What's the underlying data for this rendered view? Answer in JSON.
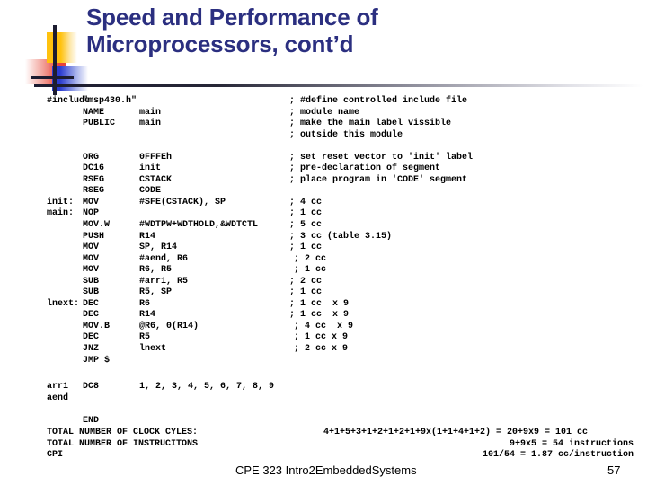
{
  "slide": {
    "title_line1": "Speed and Performance of",
    "title_line2": "Microprocessors, cont’d",
    "title_color": "#2b2f80",
    "background": "#ffffff"
  },
  "logo": {
    "yellow": "#ffc20e",
    "red": "#e8443a",
    "blue": "#2a3bd0",
    "bar": "#1c1c30"
  },
  "code": {
    "rows": [
      {
        "label": "#include",
        "mnemonic": "\"msp430.h\"",
        "operand": "",
        "comment": "; #define controlled include file"
      },
      {
        "label": "",
        "mnemonic": "NAME",
        "operand": "main",
        "comment": "; module name"
      },
      {
        "label": "",
        "mnemonic": "PUBLIC",
        "operand": "main",
        "comment": "; make the main label vissible"
      },
      {
        "label": "",
        "mnemonic": "",
        "operand": "",
        "comment": "; outside this module"
      },
      {
        "label": "",
        "mnemonic": "",
        "operand": "",
        "comment": ""
      },
      {
        "label": "",
        "mnemonic": "ORG",
        "operand": "0FFFEh",
        "comment": "; set reset vector to 'init' label"
      },
      {
        "label": "",
        "mnemonic": "DC16",
        "operand": "init",
        "comment": "; pre-declaration of segment"
      },
      {
        "label": "",
        "mnemonic": "RSEG",
        "operand": "CSTACK",
        "comment": "; place program in 'CODE' segment"
      },
      {
        "label": "",
        "mnemonic": "RSEG",
        "operand": "CODE",
        "comment": ""
      },
      {
        "label": "init:",
        "mnemonic": "MOV",
        "operand": "#SFE(CSTACK), SP",
        "comment": "; 4 cc"
      },
      {
        "label": "main:",
        "mnemonic": "NOP",
        "operand": "",
        "comment": "; 1 cc"
      },
      {
        "label": "",
        "mnemonic": "MOV.W",
        "operand": "#WDTPW+WDTHOLD,&WDTCTL",
        "comment": "; 5 cc"
      },
      {
        "label": "",
        "mnemonic": "PUSH",
        "operand": "R14",
        "comment": "; 3 cc (table 3.15)"
      },
      {
        "label": "",
        "mnemonic": "MOV",
        "operand": "SP, R14",
        "comment": "; 1 cc"
      },
      {
        "label": "",
        "mnemonic": "MOV",
        "operand": "#aend, R6",
        "comment": "; 2 cc",
        "indent": true
      },
      {
        "label": "",
        "mnemonic": "MOV",
        "operand": "R6, R5",
        "comment": "; 1 cc",
        "indent": true
      },
      {
        "label": "",
        "mnemonic": "SUB",
        "operand": "#arr1, R5",
        "comment": "; 2 cc"
      },
      {
        "label": "",
        "mnemonic": "SUB",
        "operand": "R5, SP",
        "comment": "; 1 cc"
      },
      {
        "label": "lnext:",
        "mnemonic": "DEC",
        "operand": "R6",
        "comment": "; 1 cc  x 9"
      },
      {
        "label": "",
        "mnemonic": "DEC",
        "operand": "R14",
        "comment": "; 1 cc  x 9"
      },
      {
        "label": "",
        "mnemonic": "MOV.B",
        "operand": "@R6, 0(R14)",
        "comment": "; 4 cc  x 9",
        "indent": true
      },
      {
        "label": "",
        "mnemonic": "DEC",
        "operand": "R5",
        "comment": "; 1 cc x 9",
        "indent": true
      },
      {
        "label": "",
        "mnemonic": "JNZ",
        "operand": "lnext",
        "comment": "; 2 cc x 9",
        "indent": true
      },
      {
        "label": "",
        "mnemonic": "JMP $",
        "operand": "",
        "comment": ""
      }
    ]
  },
  "data_block": {
    "rows": [
      {
        "label": "arr1",
        "mnemonic": "DC8",
        "operand": "1, 2, 3, 4, 5, 6, 7, 8, 9"
      },
      {
        "label": "aend",
        "mnemonic": "",
        "operand": ""
      },
      {
        "label": "",
        "mnemonic": "",
        "operand": ""
      },
      {
        "label": "",
        "mnemonic": "END",
        "operand": ""
      }
    ]
  },
  "totals": {
    "rows": [
      {
        "label": "TOTAL NUMBER OF CLOCK CYLES:",
        "value": "4+1+5+3+1+2+1+2+1+9x(1+1+4+1+2) = 20+9x9 = 101 cc"
      },
      {
        "label": "TOTAL NUMBER OF INSTRUCITONS",
        "value": "9+9x5 = 54 instructions"
      },
      {
        "label": "CPI",
        "value": "101/54 = 1.87 cc/instruction"
      }
    ]
  },
  "footer": {
    "course": "CPE 323 Intro2EmbeddedSystems",
    "slide_number": "57"
  }
}
